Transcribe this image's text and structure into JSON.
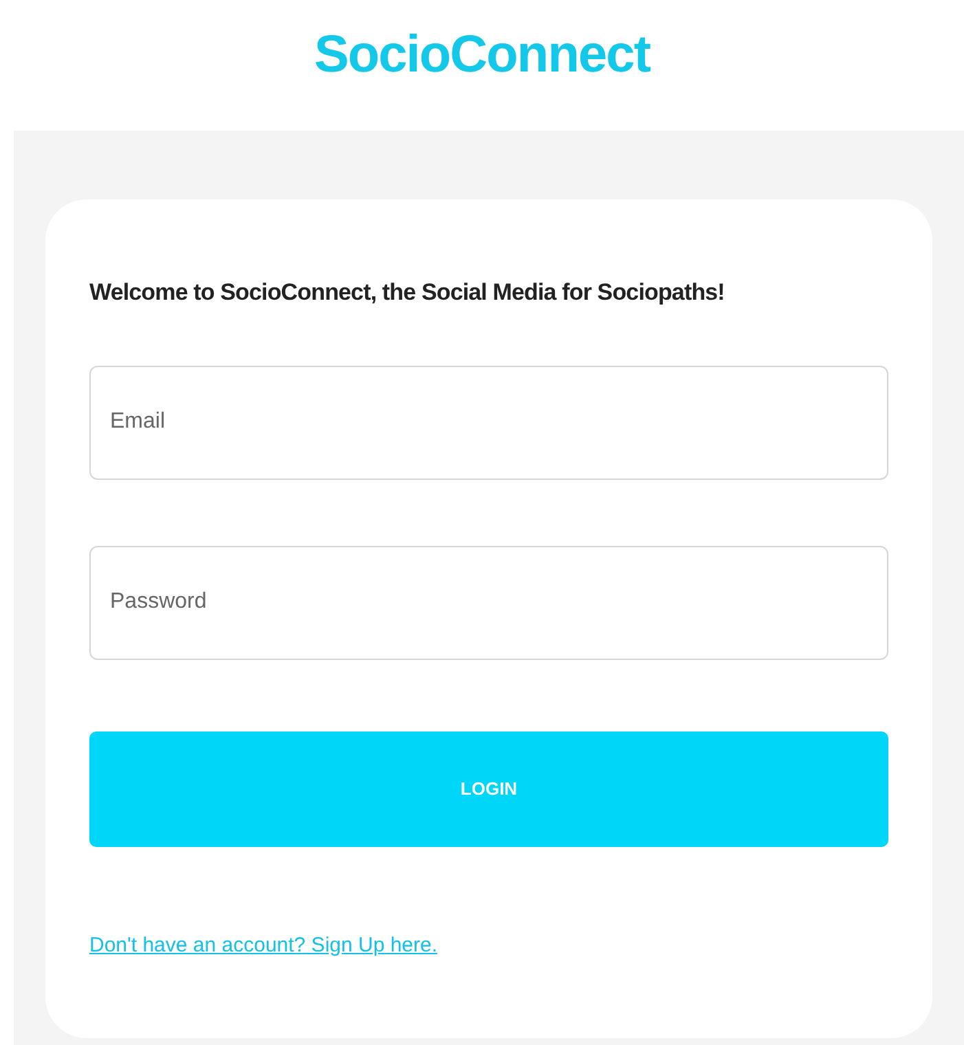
{
  "brand": {
    "title": "SocioConnect"
  },
  "login": {
    "welcome": "Welcome to SocioConnect, the Social Media for Sociopaths!",
    "fields": [
      {
        "placeholder": "Email"
      },
      {
        "placeholder": "Password"
      }
    ],
    "button": "LOGIN",
    "signup_link": "Don't have an account? Sign Up here."
  }
}
